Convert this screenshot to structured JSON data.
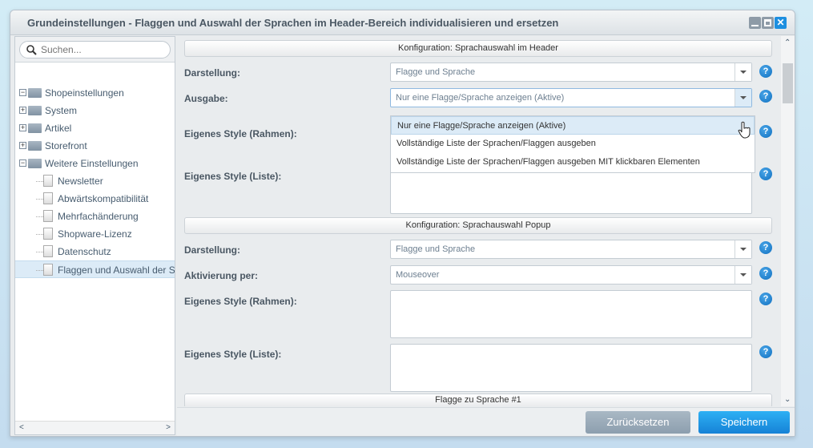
{
  "window": {
    "title": "Grundeinstellungen - Flaggen und Auswahl der Sprachen im Header-Bereich individualisieren und ersetzen"
  },
  "sidebar": {
    "search_placeholder": "Suchen...",
    "items": [
      {
        "label": "Shopeinstellungen",
        "type": "folder",
        "expanded": true
      },
      {
        "label": "System",
        "type": "folder",
        "expanded": false
      },
      {
        "label": "Artikel",
        "type": "folder",
        "expanded": false
      },
      {
        "label": "Storefront",
        "type": "folder",
        "expanded": false
      },
      {
        "label": "Weitere Einstellungen",
        "type": "folder",
        "expanded": true
      },
      {
        "label": "Newsletter",
        "type": "page"
      },
      {
        "label": "Abwärtskompatibilität",
        "type": "page"
      },
      {
        "label": "Mehrfachänderung",
        "type": "page"
      },
      {
        "label": "Shopware-Lizenz",
        "type": "page"
      },
      {
        "label": "Datenschutz",
        "type": "page"
      },
      {
        "label": "Flaggen und Auswahl der Sprachen im Header-Bereich individualisieren und ersetzen",
        "type": "page",
        "selected": true
      }
    ]
  },
  "form": {
    "section1": {
      "title": "Konfiguration: Sprachauswahl im Header",
      "darstellung_label": "Darstellung:",
      "darstellung_value": "Flagge und Sprache",
      "ausgabe_label": "Ausgabe:",
      "ausgabe_value": "Nur eine Flagge/Sprache anzeigen (Aktive)",
      "ausgabe_options": [
        "Nur eine Flagge/Sprache anzeigen (Aktive)",
        "Vollständige Liste der Sprachen/Flaggen ausgeben",
        "Vollständige Liste der Sprachen/Flaggen ausgeben MIT klickbaren Elementen"
      ],
      "style_rahmen_label": "Eigenes Style (Rahmen):",
      "style_liste_label": "Eigenes Style (Liste):"
    },
    "section2": {
      "title": "Konfiguration: Sprachauswahl Popup",
      "darstellung_label": "Darstellung:",
      "darstellung_value": "Flagge und Sprache",
      "aktivierung_label": "Aktivierung per:",
      "aktivierung_value": "Mouseover",
      "style_rahmen_label": "Eigenes Style (Rahmen):",
      "style_liste_label": "Eigenes Style (Liste):"
    },
    "section3": {
      "title": "Flagge zu Sprache #1"
    },
    "help_glyph": "?"
  },
  "buttons": {
    "reset": "Zurücksetzen",
    "save": "Speichern"
  },
  "colors": {
    "accent": "#1682d6",
    "selection": "#dcebf7"
  }
}
